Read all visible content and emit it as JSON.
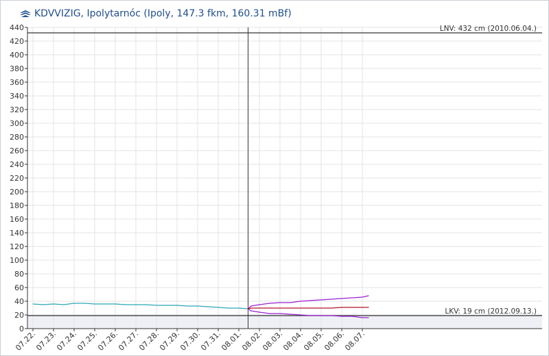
{
  "header": {
    "title": "KDVVIZIG, Ipolytarnóc (Ipoly, 147.3 fkm, 160.31 mBf)",
    "logo_icon": "kdvvizig-logo-icon"
  },
  "chart_data": {
    "type": "line",
    "ylim": [
      0,
      440
    ],
    "y_ticks": [
      0,
      20,
      40,
      60,
      80,
      100,
      120,
      140,
      160,
      180,
      200,
      220,
      240,
      260,
      280,
      300,
      320,
      340,
      360,
      380,
      400,
      420,
      440
    ],
    "x_tick_labels": [
      "07.22.",
      "07.23.",
      "07.24.",
      "07.25.",
      "07.26.",
      "07.27.",
      "07.28.",
      "07.29.",
      "07.30.",
      "07.31.",
      "08.01.",
      "08.02.",
      "08.03.",
      "08.04.",
      "08.05.",
      "08.06.",
      "08.07."
    ],
    "grid": true,
    "now_index": 10.45,
    "reference_lines": [
      {
        "label": "LNV: 432 cm (2010.06.04.)",
        "value": 432
      },
      {
        "label": "LKV: 19 cm (2012.09.13.)",
        "value": 19
      }
    ],
    "series": [
      {
        "color": "#2aa6b5",
        "x": [
          0,
          0.5,
          1,
          1.5,
          2,
          2.5,
          3,
          3.5,
          4,
          4.5,
          5,
          5.5,
          6,
          6.5,
          7,
          7.5,
          8,
          8.5,
          9,
          9.5,
          10,
          10.45
        ],
        "values": [
          36,
          35,
          36,
          35,
          37,
          37,
          36,
          36,
          36,
          35,
          35,
          35,
          34,
          34,
          34,
          33,
          33,
          32,
          31,
          30,
          30,
          29
        ]
      },
      {
        "color": "#9a1fd1",
        "x": [
          10.45,
          10.6,
          11,
          11.5,
          12,
          12.5,
          13,
          13.5,
          14,
          14.5,
          15,
          15.5,
          16,
          16.3
        ],
        "values": [
          29,
          33,
          35,
          37,
          38,
          38,
          40,
          41,
          42,
          43,
          44,
          45,
          46,
          48
        ]
      },
      {
        "color": "#b3142a",
        "x": [
          10.45,
          10.6,
          11,
          11.5,
          12,
          12.5,
          13,
          13.5,
          14,
          14.5,
          15,
          15.5,
          16,
          16.3
        ],
        "values": [
          29,
          30,
          30,
          30,
          30,
          30,
          30,
          30,
          30,
          30,
          31,
          31,
          31,
          31
        ]
      },
      {
        "color": "#9a1fd1",
        "x": [
          10.45,
          10.6,
          11,
          11.5,
          12,
          12.5,
          13,
          13.5,
          14,
          14.5,
          15,
          15.5,
          16,
          16.3
        ],
        "values": [
          29,
          26,
          24,
          22,
          22,
          21,
          20,
          19,
          19,
          19,
          18,
          18,
          16,
          16
        ]
      }
    ]
  },
  "colors": {
    "grid": "#e3e3e3",
    "axis": "#333333",
    "now_line": "#333333",
    "below_fill": "#eef0f6"
  }
}
